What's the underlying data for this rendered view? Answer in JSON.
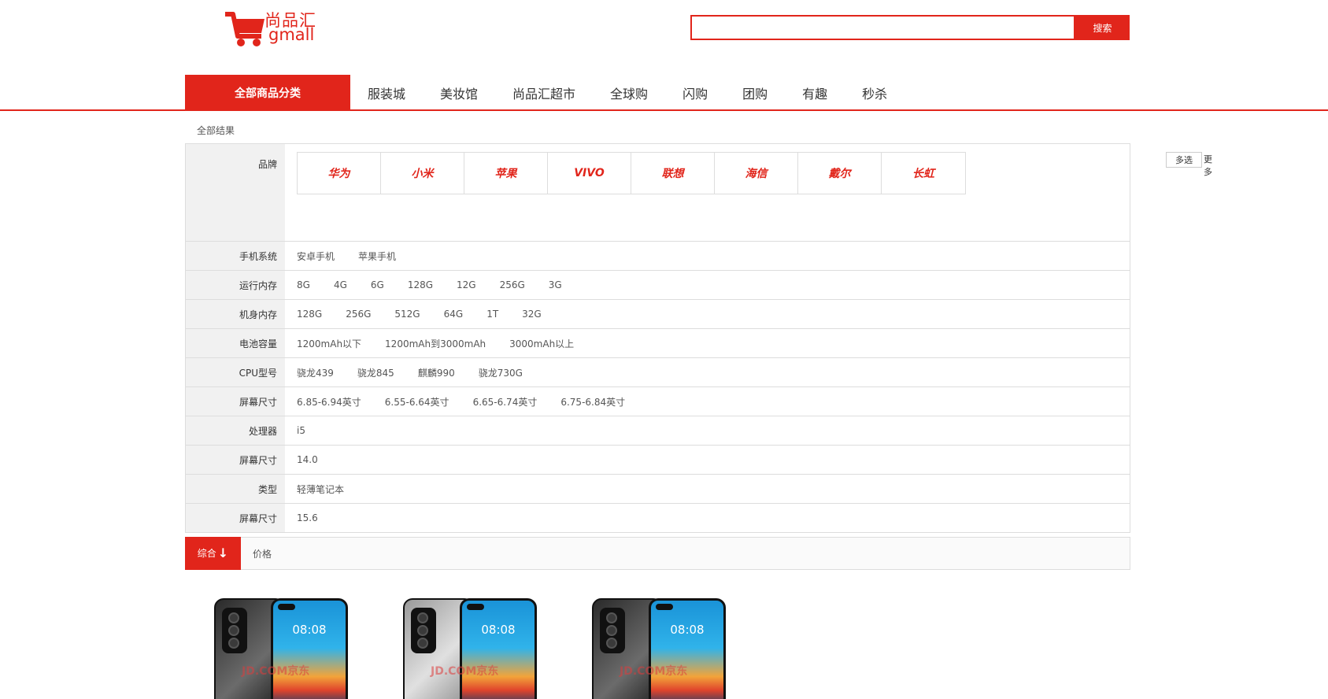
{
  "header": {
    "logo_cn": "尚品汇",
    "logo_en": "gmall",
    "search_placeholder": "",
    "search_button": "搜索"
  },
  "nav": {
    "all_categories": "全部商品分类",
    "items": [
      "服装城",
      "美妆馆",
      "尚品汇超市",
      "全球购",
      "闪购",
      "团购",
      "有趣",
      "秒杀"
    ]
  },
  "breadcrumb": "全部结果",
  "filter": {
    "brand_label": "品牌",
    "brands": [
      "华为",
      "小米",
      "苹果",
      "VIVO",
      "联想",
      "海信",
      "戴尔",
      "长虹"
    ],
    "multi_select": "多选",
    "more": "更多",
    "attrs": [
      {
        "label": "手机系统",
        "values": [
          "安卓手机",
          "苹果手机"
        ]
      },
      {
        "label": "运行内存",
        "values": [
          "8G",
          "4G",
          "6G",
          "128G",
          "12G",
          "256G",
          "3G"
        ]
      },
      {
        "label": "机身内存",
        "values": [
          "128G",
          "256G",
          "512G",
          "64G",
          "1T",
          "32G"
        ]
      },
      {
        "label": "电池容量",
        "values": [
          "1200mAh以下",
          "1200mAh到3000mAh",
          "3000mAh以上"
        ]
      },
      {
        "label": "CPU型号",
        "values": [
          "骁龙439",
          "骁龙845",
          "麒麟990",
          "骁龙730G"
        ]
      },
      {
        "label": "屏幕尺寸",
        "values": [
          "6.85-6.94英寸",
          "6.55-6.64英寸",
          "6.65-6.74英寸",
          "6.75-6.84英寸"
        ]
      },
      {
        "label": "处理器",
        "values": [
          "i5"
        ]
      },
      {
        "label": "屏幕尺寸",
        "values": [
          "14.0"
        ]
      },
      {
        "label": "类型",
        "values": [
          "轻薄笔记本"
        ]
      },
      {
        "label": "屏幕尺寸",
        "values": [
          "15.6"
        ]
      }
    ]
  },
  "sort": {
    "active": "综合",
    "arrow": "↓",
    "price": "价格"
  },
  "products": [
    {
      "clock": "08:08",
      "watermark": "JD.COM京东",
      "color": "black"
    },
    {
      "clock": "08:08",
      "watermark": "JD.COM京东",
      "color": "silver"
    },
    {
      "clock": "08:08",
      "watermark": "JD.COM京东",
      "color": "black"
    }
  ],
  "colors": {
    "accent": "#e1251b"
  }
}
